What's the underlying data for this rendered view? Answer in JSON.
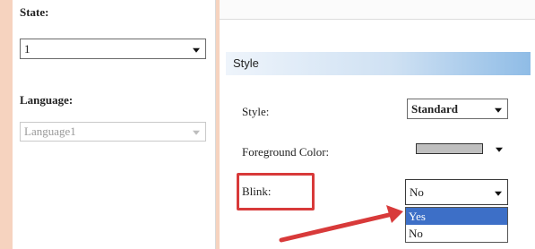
{
  "left_panel": {
    "state_label": "State:",
    "state_value": "1",
    "language_label": "Language:",
    "language_value": "Language1"
  },
  "style_section": {
    "header": "Style",
    "style_label": "Style:",
    "style_value": "Standard",
    "fg_color_label": "Foreground Color:",
    "fg_color_value": "#bfbfbf",
    "blink_label": "Blink:",
    "blink_value": "No"
  },
  "blink_dropdown": {
    "options": [
      "Yes",
      "No"
    ],
    "highlighted": "Yes"
  },
  "annotation_color": "#d83a3a"
}
